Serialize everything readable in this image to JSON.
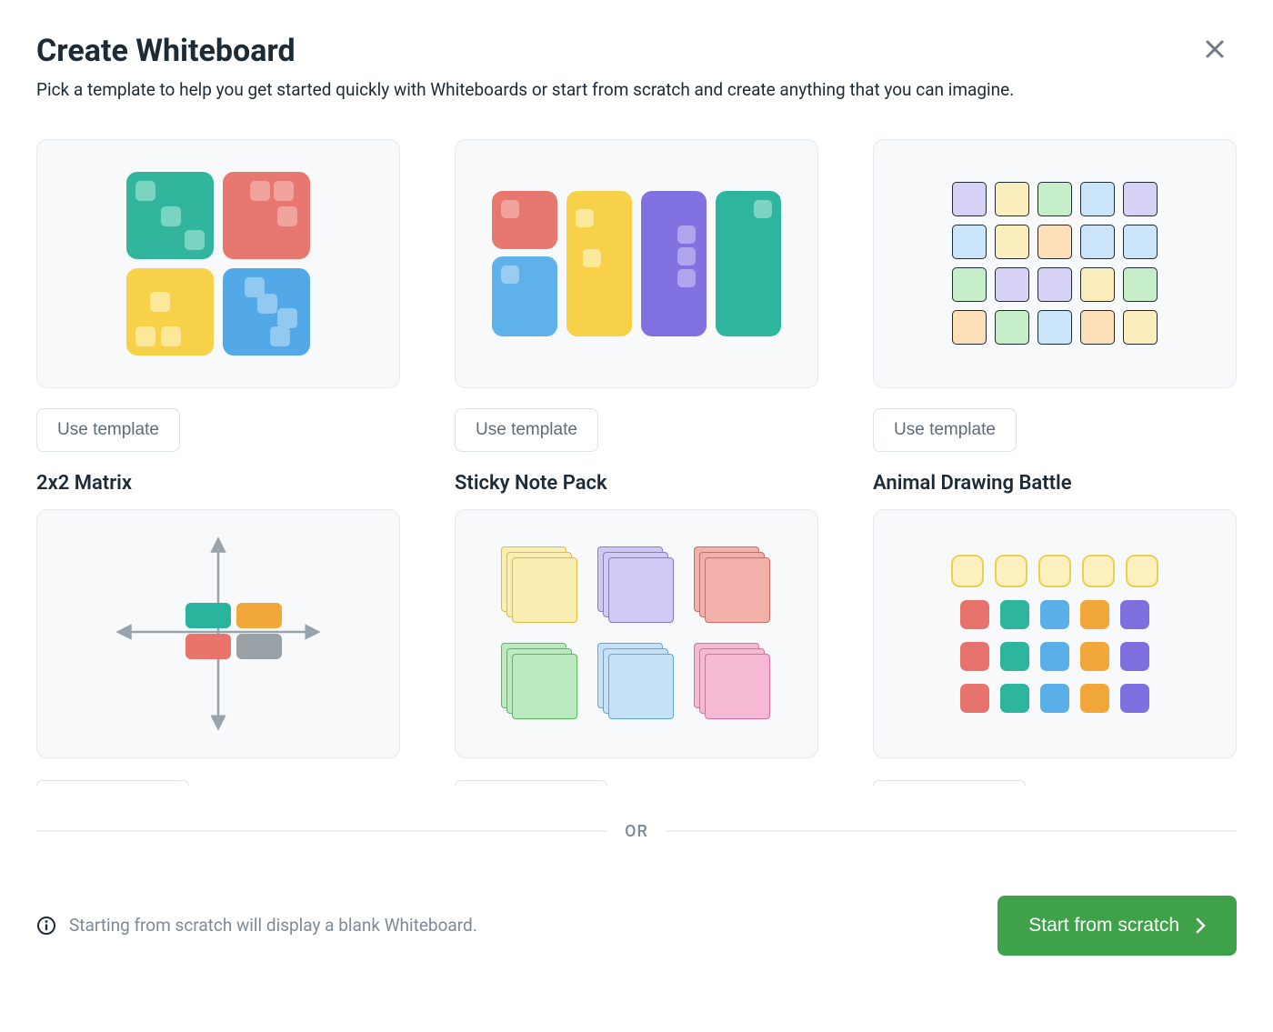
{
  "title": "Create Whiteboard",
  "subtitle": "Pick a template to help you get started quickly with Whiteboards or start from scratch and create anything that you can imagine.",
  "divider_label": "OR",
  "footer_hint": "Starting from scratch will display a blank Whiteboard.",
  "primary_button": "Start from scratch",
  "use_template_label": "Use template",
  "templates": {
    "row1": {
      "t0": "",
      "t1": "",
      "t2": ""
    },
    "row2_names": {
      "t0": "2x2 Matrix",
      "t1": "Sticky Note Pack",
      "t2": "Animal Drawing Battle"
    }
  },
  "colors": {
    "primary_green": "#40a14b",
    "card_bg": "#f8f9fa",
    "card_border": "#e6eaed",
    "text_muted": "#7d8a96"
  }
}
